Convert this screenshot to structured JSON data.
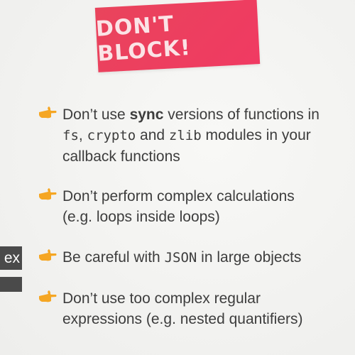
{
  "title": "DON'T BLOCK!",
  "bullets": [
    {
      "icon": "pointing-hand-icon",
      "line1": {
        "pre": "Don’t use ",
        "bold": "sync",
        "post": " versions of functions in"
      },
      "line2": {
        "m1": "fs",
        "sep1": ", ",
        "m2": "crypto",
        "sep2": " and ",
        "m3": "zlib",
        "post": " modules in your"
      },
      "line3": "callback functions"
    },
    {
      "icon": "pointing-hand-icon",
      "line1": "Don’t perform complex calculations",
      "line2": "(e.g. loops inside loops)"
    },
    {
      "icon": "pointing-hand-icon",
      "line1": {
        "pre": "Be careful with ",
        "mono": "JSON",
        "post": " in large objects"
      }
    },
    {
      "icon": "pointing-hand-icon",
      "line1": "Don’t use too complex regular",
      "line2": "expressions (e.g. nested quantifiers)"
    }
  ],
  "side_overlay": {
    "fragment": "ex"
  },
  "colors": {
    "banner": "#ee3f5f",
    "hand": "#f5a623",
    "text": "#3d3d3d",
    "overlay": "#4a4a4a"
  }
}
